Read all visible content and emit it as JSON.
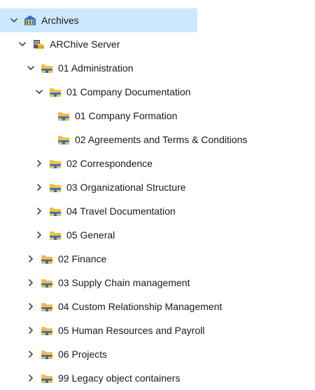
{
  "colors": {
    "selection": "#cce8ff",
    "folder_yellow": "#f3bf47",
    "folder_blue": "#2f6fc2",
    "chevron": "#444444"
  },
  "tree": [
    {
      "label": "Archives",
      "icon": "archives-icon",
      "expanded": true,
      "depth": 0,
      "selected": true
    },
    {
      "label": "ARChive Server",
      "icon": "server-icon",
      "expanded": true,
      "depth": 1
    },
    {
      "label": "01 Administration",
      "icon": "folder-icon",
      "expanded": true,
      "depth": 2
    },
    {
      "label": "01 Company Documentation",
      "icon": "folder-icon",
      "expanded": true,
      "depth": 3
    },
    {
      "label": "01 Company Formation",
      "icon": "folder-icon",
      "expanded": null,
      "depth": 4
    },
    {
      "label": "02 Agreements and Terms & Conditions",
      "icon": "folder-icon",
      "expanded": null,
      "depth": 4
    },
    {
      "label": "02 Correspondence",
      "icon": "folder-icon",
      "expanded": false,
      "depth": 3
    },
    {
      "label": "03 Organizational Structure",
      "icon": "folder-icon",
      "expanded": false,
      "depth": 3
    },
    {
      "label": "04 Travel Documentation",
      "icon": "folder-icon",
      "expanded": false,
      "depth": 3
    },
    {
      "label": "05 General",
      "icon": "folder-icon",
      "expanded": false,
      "depth": 3
    },
    {
      "label": "02 Finance",
      "icon": "folder-icon",
      "expanded": false,
      "depth": 2
    },
    {
      "label": "03 Supply Chain management",
      "icon": "folder-icon",
      "expanded": false,
      "depth": 2
    },
    {
      "label": "04 Custom Relationship Management",
      "icon": "folder-icon",
      "expanded": false,
      "depth": 2
    },
    {
      "label": "05 Human Resources and Payroll",
      "icon": "folder-icon",
      "expanded": false,
      "depth": 2
    },
    {
      "label": "06 Projects",
      "icon": "folder-icon",
      "expanded": false,
      "depth": 2
    },
    {
      "label": "99 Legacy object containers",
      "icon": "folder-icon",
      "expanded": false,
      "depth": 2
    }
  ]
}
